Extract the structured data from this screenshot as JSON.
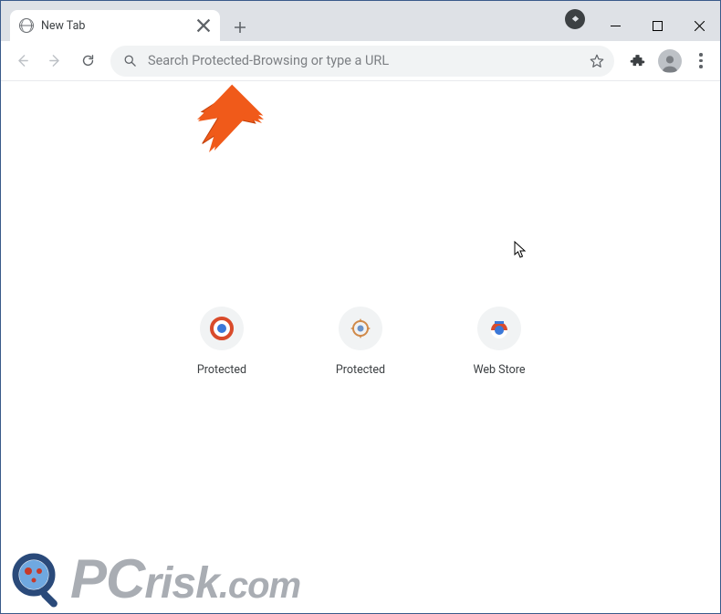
{
  "window": {
    "tab_title": "New Tab",
    "controls": {
      "min": "minimize",
      "max": "maximize",
      "close": "close"
    }
  },
  "toolbar": {
    "back": "Back",
    "forward": "Forward",
    "reload": "Reload",
    "omnibox_placeholder": "Search Protected-Browsing or type a URL",
    "bookmark": "Bookmark",
    "extensions": "Extensions",
    "profile": "Profile",
    "menu": "Menu"
  },
  "content": {
    "shortcuts": [
      {
        "label": "Protected",
        "icon": "shield"
      },
      {
        "label": "Protected",
        "icon": "gear"
      },
      {
        "label": "Web Store",
        "icon": "bag"
      }
    ]
  },
  "watermark": {
    "text_pc": "PC",
    "text_rest": "risk",
    "text_dom": ".com"
  },
  "colors": {
    "tabstrip_bg": "#dee1e6",
    "omnibox_bg": "#f1f3f4",
    "text_muted": "#5f6368",
    "arrow": "#f05a1a"
  }
}
